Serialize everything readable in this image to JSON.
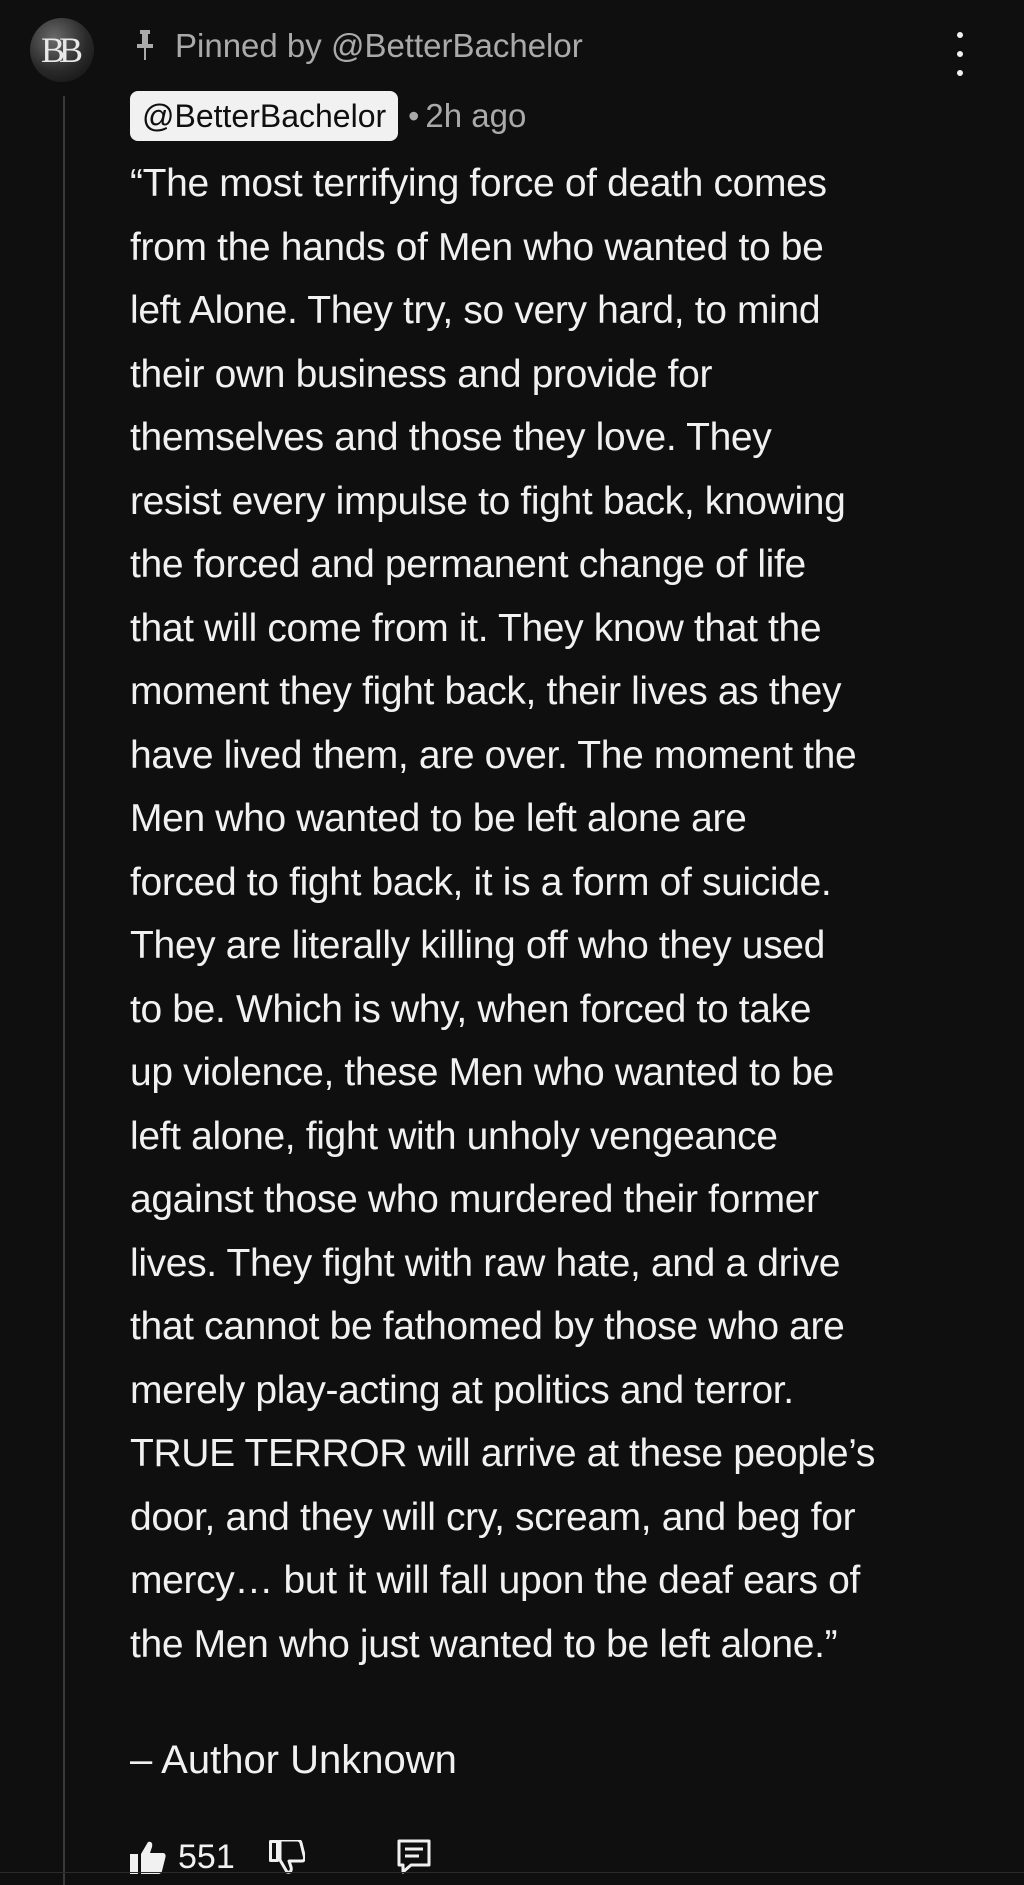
{
  "comment": {
    "avatar_initials": "BB",
    "pinned_label": "Pinned by @BetterBachelor",
    "author": "@BetterBachelor",
    "separator": "•",
    "timestamp": "2h ago",
    "body": "“The most terrifying force of death comes\nfrom the hands of Men who wanted to be\nleft Alone. They try, so very hard, to mind\ntheir own business and provide for\nthemselves and those they love. They\nresist every impulse to fight back, knowing\nthe forced and permanent change of life\nthat will come from it. They know that the\nmoment they fight back, their lives as they\nhave lived them, are over. The moment the\nMen who wanted to be left alone are\nforced to fight back, it is a form of suicide.\nThey are literally killing off who they used\nto be. Which is why, when forced to take\nup violence, these Men who wanted to be\nleft alone, fight with unholy vengeance\nagainst those who murdered their former\nlives. They fight with raw hate, and a drive\nthat cannot be fathomed by those who are\nmerely play-acting at politics and terror.\nTRUE TERROR will arrive at these people’s\ndoor, and they will cry, scream, and beg for\nmercy… but it will fall upon the deaf ears of\nthe Men who just wanted to be left alone.”",
    "attribution": "– Author Unknown",
    "like_count": "551"
  },
  "icons": {
    "pin": "pin-icon",
    "more": "more-vertical-icon",
    "like": "thumbs-up-filled-icon",
    "dislike": "thumbs-down-icon",
    "reply": "reply-comment-icon"
  },
  "colors": {
    "background": "#0f0f0f",
    "text_primary": "#f1f1f1",
    "text_secondary": "#aaaaaa",
    "author_chip_bg": "#f1f1f1",
    "author_chip_text": "#0f0f0f"
  }
}
